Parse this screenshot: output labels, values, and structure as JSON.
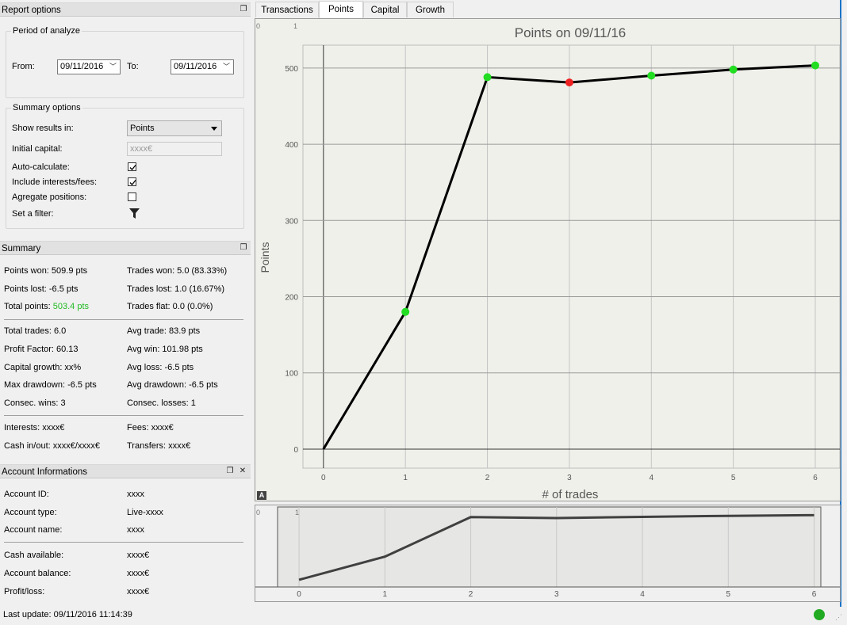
{
  "report_options": {
    "title": "Report options",
    "period": {
      "legend": "Period of analyze",
      "from_label": "From:",
      "from_value": "09/11/2016",
      "to_label": "To:",
      "to_value": "09/11/2016"
    },
    "summary_options": {
      "legend": "Summary options",
      "show_results_label": "Show results in:",
      "show_results_value": "Points",
      "initial_capital_label": "Initial capital:",
      "initial_capital_placeholder": "xxxx€",
      "auto_calculate_label": "Auto-calculate:",
      "auto_calculate_checked": true,
      "include_interests_label": "Include interests/fees:",
      "include_interests_checked": true,
      "aggregate_label": "Agregate positions:",
      "aggregate_checked": false,
      "filter_label": "Set a filter:",
      "filter_icon": "funnel-icon"
    }
  },
  "summary": {
    "title": "Summary",
    "points_won": "Points won: 509.9 pts",
    "points_lost": "Points lost: -6.5 pts",
    "total_points_label": "Total points: ",
    "total_points_value": "503.4 pts",
    "trades_won": "Trades won: 5.0 (83.33%)",
    "trades_lost": "Trades lost: 1.0 (16.67%)",
    "trades_flat": "Trades flat: 0.0 (0.0%)",
    "total_trades": "Total trades: 6.0",
    "profit_factor": "Profit Factor: 60.13",
    "capital_growth": "Capital growth: xx%",
    "max_drawdown": "Max drawdown: -6.5 pts",
    "consec_wins": "Consec. wins: 3",
    "avg_trade": "Avg trade: 83.9 pts",
    "avg_win": "Avg win: 101.98 pts",
    "avg_loss": "Avg loss: -6.5 pts",
    "avg_drawdown": "Avg drawdown: -6.5 pts",
    "consec_losses": "Consec. losses: 1",
    "interests": "Interests: xxxx€",
    "cash_inout": "Cash in/out: xxxx€/xxxx€",
    "fees": "Fees: xxxx€",
    "transfers": "Transfers: xxxx€"
  },
  "account": {
    "title": "Account Informations",
    "rows": [
      {
        "label": "Account ID:",
        "value": "xxxx"
      },
      {
        "label": "Account type:",
        "value": "Live-xxxx"
      },
      {
        "label": "Account name:",
        "value": "xxxx"
      }
    ],
    "rows2": [
      {
        "label": "Cash available:",
        "value": "xxxx€"
      },
      {
        "label": "Account balance:",
        "value": "xxxx€"
      },
      {
        "label": "Profit/loss:",
        "value": "xxxx€"
      }
    ]
  },
  "tabs": [
    {
      "label": "Transactions",
      "active": false
    },
    {
      "label": "Points",
      "active": true
    },
    {
      "label": "Capital",
      "active": false
    },
    {
      "label": "Growth",
      "active": false
    }
  ],
  "status": {
    "last_update": "Last update: 09/11/2016 11:14:39",
    "indicator_color": "#22aa22"
  },
  "chart_data": {
    "type": "line",
    "title": "Points on 09/11/16",
    "xlabel": "# of trades",
    "ylabel": "Points",
    "x": [
      0,
      1,
      2,
      3,
      4,
      5,
      6
    ],
    "y": [
      0,
      180,
      488,
      481,
      490,
      498,
      503.4
    ],
    "point_colors": [
      null,
      "#22dd22",
      "#22dd22",
      "#ee2222",
      "#22dd22",
      "#22dd22",
      "#22dd22"
    ],
    "xlim": [
      -0.25,
      6.3
    ],
    "ylim": [
      -25,
      530
    ],
    "xticks": [
      "0",
      "1",
      "2",
      "3",
      "4",
      "5",
      "6"
    ],
    "yticks": [
      "0",
      "100",
      "200",
      "300",
      "400",
      "500"
    ],
    "grid": true,
    "corner_labels": [
      "0",
      "1"
    ],
    "overview_xticks": [
      "0",
      "1",
      "2",
      "3",
      "4",
      "5",
      "6"
    ],
    "overview_corner_labels": [
      "0",
      "1"
    ]
  }
}
